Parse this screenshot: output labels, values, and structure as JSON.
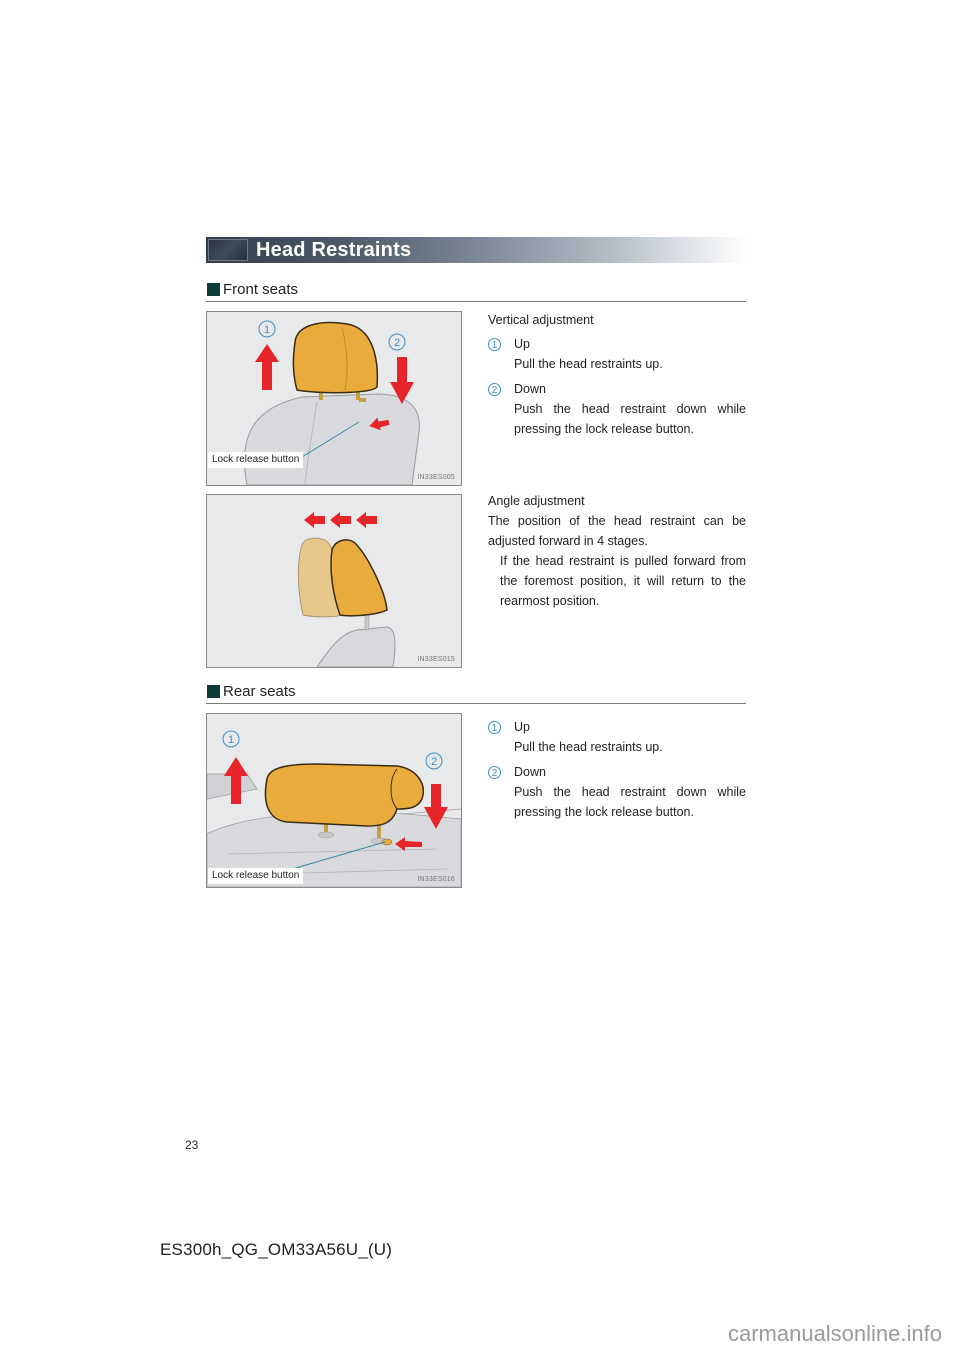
{
  "title": "Head Restraints",
  "sections": [
    {
      "heading": "Front seats",
      "figures": [
        {
          "code": "IN33ES005",
          "callout_label": "Lock release button",
          "markers": [
            "1",
            "2"
          ],
          "text": {
            "intro": "Vertical adjustment",
            "items": [
              {
                "num": "1",
                "title": "Up",
                "desc": "Pull the head restraints up."
              },
              {
                "num": "2",
                "title": "Down",
                "desc": "Push the head restraint down while pressing the lock release button."
              }
            ]
          }
        },
        {
          "code": "IN33ES015",
          "text": {
            "intro": "Angle adjustment",
            "body": "The position of the head restraint can be adjusted forward in 4 stages.",
            "note": "If the head restraint is pulled forward from the foremost position, it will return to the rearmost position."
          }
        }
      ]
    },
    {
      "heading": "Rear seats",
      "figures": [
        {
          "code": "IN33ES016",
          "callout_label": "Lock release button",
          "markers": [
            "1",
            "2"
          ],
          "text": {
            "items": [
              {
                "num": "1",
                "title": "Up",
                "desc": "Pull the head restraints up."
              },
              {
                "num": "2",
                "title": "Down",
                "desc": "Push the head restraint down while pressing the lock release button."
              }
            ]
          }
        }
      ]
    }
  ],
  "footer": {
    "page_number": "23",
    "document_code": "ES300h_QG_OM33A56U_(U)",
    "watermark": "carmanualsonline.info"
  },
  "colors": {
    "arrow_red": "#e8242b",
    "marker_blue": "#3a8fc9",
    "headrest_yellow": "#e8ab3c",
    "section_square": "#0e3b3a"
  }
}
